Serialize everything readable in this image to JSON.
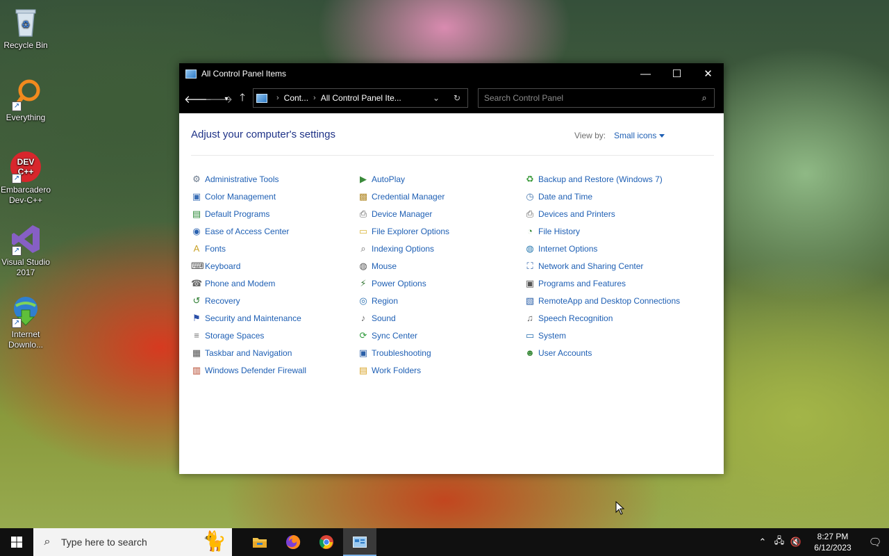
{
  "desktop": {
    "icons": [
      {
        "label": "Recycle Bin",
        "icon": "recycle-bin-icon"
      },
      {
        "label": "Everything",
        "icon": "everything-search-icon"
      },
      {
        "label": "Embarcadero Dev-C++",
        "icon": "devcpp-icon",
        "badge": "DEV C++"
      },
      {
        "label": "Visual Studio 2017",
        "icon": "visual-studio-icon"
      },
      {
        "label": "Internet Downlo...",
        "icon": "internet-download-manager-icon"
      }
    ]
  },
  "window": {
    "title": "All Control Panel Items",
    "controls": {
      "minimize": "—",
      "maximize": "☐",
      "close": "✕"
    },
    "address": {
      "crumbs": [
        "Cont...",
        "All Control Panel Ite..."
      ]
    },
    "search": {
      "placeholder": "Search Control Panel"
    },
    "heading": "Adjust your computer's settings",
    "view_by": {
      "label": "View by:",
      "value": "Small icons"
    },
    "columns": [
      [
        {
          "label": "Administrative Tools",
          "icon": "admin-tools-icon",
          "glyph": "⚙",
          "color": "#6b7a8c"
        },
        {
          "label": "Color Management",
          "icon": "color-management-icon",
          "glyph": "▣",
          "color": "#3b6fb6"
        },
        {
          "label": "Default Programs",
          "icon": "default-programs-icon",
          "glyph": "▤",
          "color": "#2e8b3a"
        },
        {
          "label": "Ease of Access Center",
          "icon": "ease-of-access-icon",
          "glyph": "◉",
          "color": "#2a62b0"
        },
        {
          "label": "Fonts",
          "icon": "fonts-icon",
          "glyph": "A",
          "color": "#c9a227"
        },
        {
          "label": "Keyboard",
          "icon": "keyboard-icon",
          "glyph": "⌨",
          "color": "#555555"
        },
        {
          "label": "Phone and Modem",
          "icon": "phone-modem-icon",
          "glyph": "☎",
          "color": "#666666"
        },
        {
          "label": "Recovery",
          "icon": "recovery-icon",
          "glyph": "↺",
          "color": "#2e7d32"
        },
        {
          "label": "Security and Maintenance",
          "icon": "security-flag-icon",
          "glyph": "⚑",
          "color": "#2a4fa8"
        },
        {
          "label": "Storage Spaces",
          "icon": "storage-spaces-icon",
          "glyph": "≡",
          "color": "#777777"
        },
        {
          "label": "Taskbar and Navigation",
          "icon": "taskbar-navigation-icon",
          "glyph": "▦",
          "color": "#555555"
        },
        {
          "label": "Windows Defender Firewall",
          "icon": "firewall-icon",
          "glyph": "▥",
          "color": "#b5452a"
        }
      ],
      [
        {
          "label": "AutoPlay",
          "icon": "autoplay-icon",
          "glyph": "▶",
          "color": "#3a8a3a"
        },
        {
          "label": "Credential Manager",
          "icon": "credential-manager-icon",
          "glyph": "▩",
          "color": "#b38b2c"
        },
        {
          "label": "Device Manager",
          "icon": "device-manager-icon",
          "glyph": "⎙",
          "color": "#555555"
        },
        {
          "label": "File Explorer Options",
          "icon": "file-explorer-options-icon",
          "glyph": "▭",
          "color": "#d9b43a"
        },
        {
          "label": "Indexing Options",
          "icon": "indexing-options-icon",
          "glyph": "⌕",
          "color": "#666666"
        },
        {
          "label": "Mouse",
          "icon": "mouse-icon",
          "glyph": "◍",
          "color": "#555555"
        },
        {
          "label": "Power Options",
          "icon": "power-options-icon",
          "glyph": "⚡",
          "color": "#3a7a3a"
        },
        {
          "label": "Region",
          "icon": "region-icon",
          "glyph": "◎",
          "color": "#2a6fb0"
        },
        {
          "label": "Sound",
          "icon": "sound-icon",
          "glyph": "♪",
          "color": "#666666"
        },
        {
          "label": "Sync Center",
          "icon": "sync-center-icon",
          "glyph": "⟳",
          "color": "#2e9a3a"
        },
        {
          "label": "Troubleshooting",
          "icon": "troubleshooting-icon",
          "glyph": "▣",
          "color": "#2a5fa8"
        },
        {
          "label": "Work Folders",
          "icon": "work-folders-icon",
          "glyph": "▤",
          "color": "#d9a52a"
        }
      ],
      [
        {
          "label": "Backup and Restore (Windows 7)",
          "icon": "backup-restore-icon",
          "glyph": "♻",
          "color": "#3a9a3a"
        },
        {
          "label": "Date and Time",
          "icon": "date-time-icon",
          "glyph": "◷",
          "color": "#4a7ab0"
        },
        {
          "label": "Devices and Printers",
          "icon": "devices-printers-icon",
          "glyph": "⎙",
          "color": "#555555"
        },
        {
          "label": "File History",
          "icon": "file-history-icon",
          "glyph": "◔",
          "color": "#3a8a3a"
        },
        {
          "label": "Internet Options",
          "icon": "internet-options-icon",
          "glyph": "◍",
          "color": "#2a7ab0"
        },
        {
          "label": "Network and Sharing Center",
          "icon": "network-sharing-icon",
          "glyph": "⛶",
          "color": "#2a5fa8"
        },
        {
          "label": "Programs and Features",
          "icon": "programs-features-icon",
          "glyph": "▣",
          "color": "#555555"
        },
        {
          "label": "RemoteApp and Desktop Connections",
          "icon": "remoteapp-icon",
          "glyph": "▧",
          "color": "#2a5fa8"
        },
        {
          "label": "Speech Recognition",
          "icon": "speech-recognition-icon",
          "glyph": "♫",
          "color": "#666666"
        },
        {
          "label": "System",
          "icon": "system-icon",
          "glyph": "▭",
          "color": "#2a6fb0"
        },
        {
          "label": "User Accounts",
          "icon": "user-accounts-icon",
          "glyph": "☻",
          "color": "#3a8a3a"
        }
      ]
    ]
  },
  "taskbar": {
    "search_text": "Type here to search",
    "apps": [
      "file-explorer-icon",
      "firefox-icon",
      "chrome-icon",
      "control-panel-icon"
    ],
    "tray": {
      "time": "8:27 PM",
      "date": "6/12/2023"
    }
  }
}
